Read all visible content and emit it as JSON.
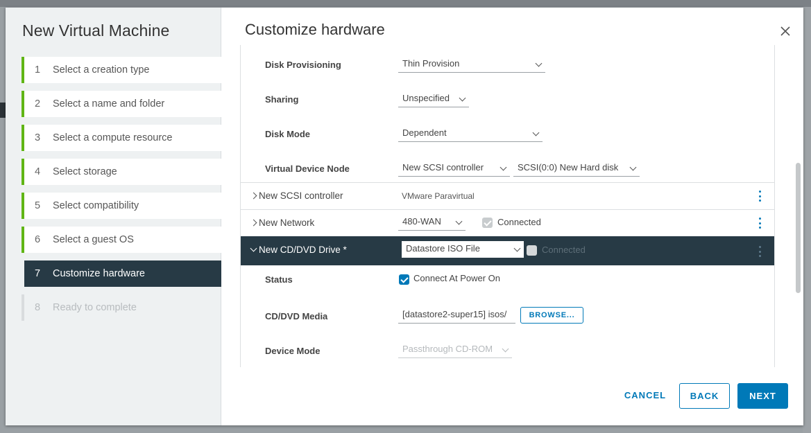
{
  "wizard": {
    "title": "New Virtual Machine",
    "steps": [
      {
        "num": "1",
        "label": "Select a creation type",
        "state": "done"
      },
      {
        "num": "2",
        "label": "Select a name and folder",
        "state": "done"
      },
      {
        "num": "3",
        "label": "Select a compute resource",
        "state": "done"
      },
      {
        "num": "4",
        "label": "Select storage",
        "state": "done"
      },
      {
        "num": "5",
        "label": "Select compatibility",
        "state": "done"
      },
      {
        "num": "6",
        "label": "Select a guest OS",
        "state": "done"
      },
      {
        "num": "7",
        "label": "Customize hardware",
        "state": "active"
      },
      {
        "num": "8",
        "label": "Ready to complete",
        "state": "pending"
      }
    ]
  },
  "content": {
    "title": "Customize hardware",
    "disk_provisioning": {
      "label": "Disk Provisioning",
      "value": "Thin Provision"
    },
    "sharing": {
      "label": "Sharing",
      "value": "Unspecified"
    },
    "disk_mode": {
      "label": "Disk Mode",
      "value": "Dependent"
    },
    "virtual_device_node": {
      "label": "Virtual Device Node",
      "controller": "New SCSI controller",
      "node": "SCSI(0:0) New Hard disk"
    },
    "scsi_controller": {
      "label": "New SCSI controller",
      "value": "VMware Paravirtual"
    },
    "network": {
      "label": "New Network",
      "value": "480-WAN",
      "connected_label": "Connected"
    },
    "cdrom": {
      "label": "New CD/DVD Drive *",
      "value": "Datastore ISO File",
      "connected_label": "Connected"
    },
    "status": {
      "label": "Status",
      "checkbox_label": "Connect At Power On"
    },
    "media": {
      "label": "CD/DVD Media",
      "value": "[datastore2-super15] isos/",
      "browse_label": "BROWSE..."
    },
    "device_mode": {
      "label": "Device Mode",
      "value": "Passthrough CD-ROM"
    }
  },
  "footer": {
    "cancel": "CANCEL",
    "back": "BACK",
    "next": "NEXT"
  },
  "colors": {
    "accent": "#0079b8",
    "active_step_bg": "#273a45",
    "done_marker": "#60b515"
  }
}
